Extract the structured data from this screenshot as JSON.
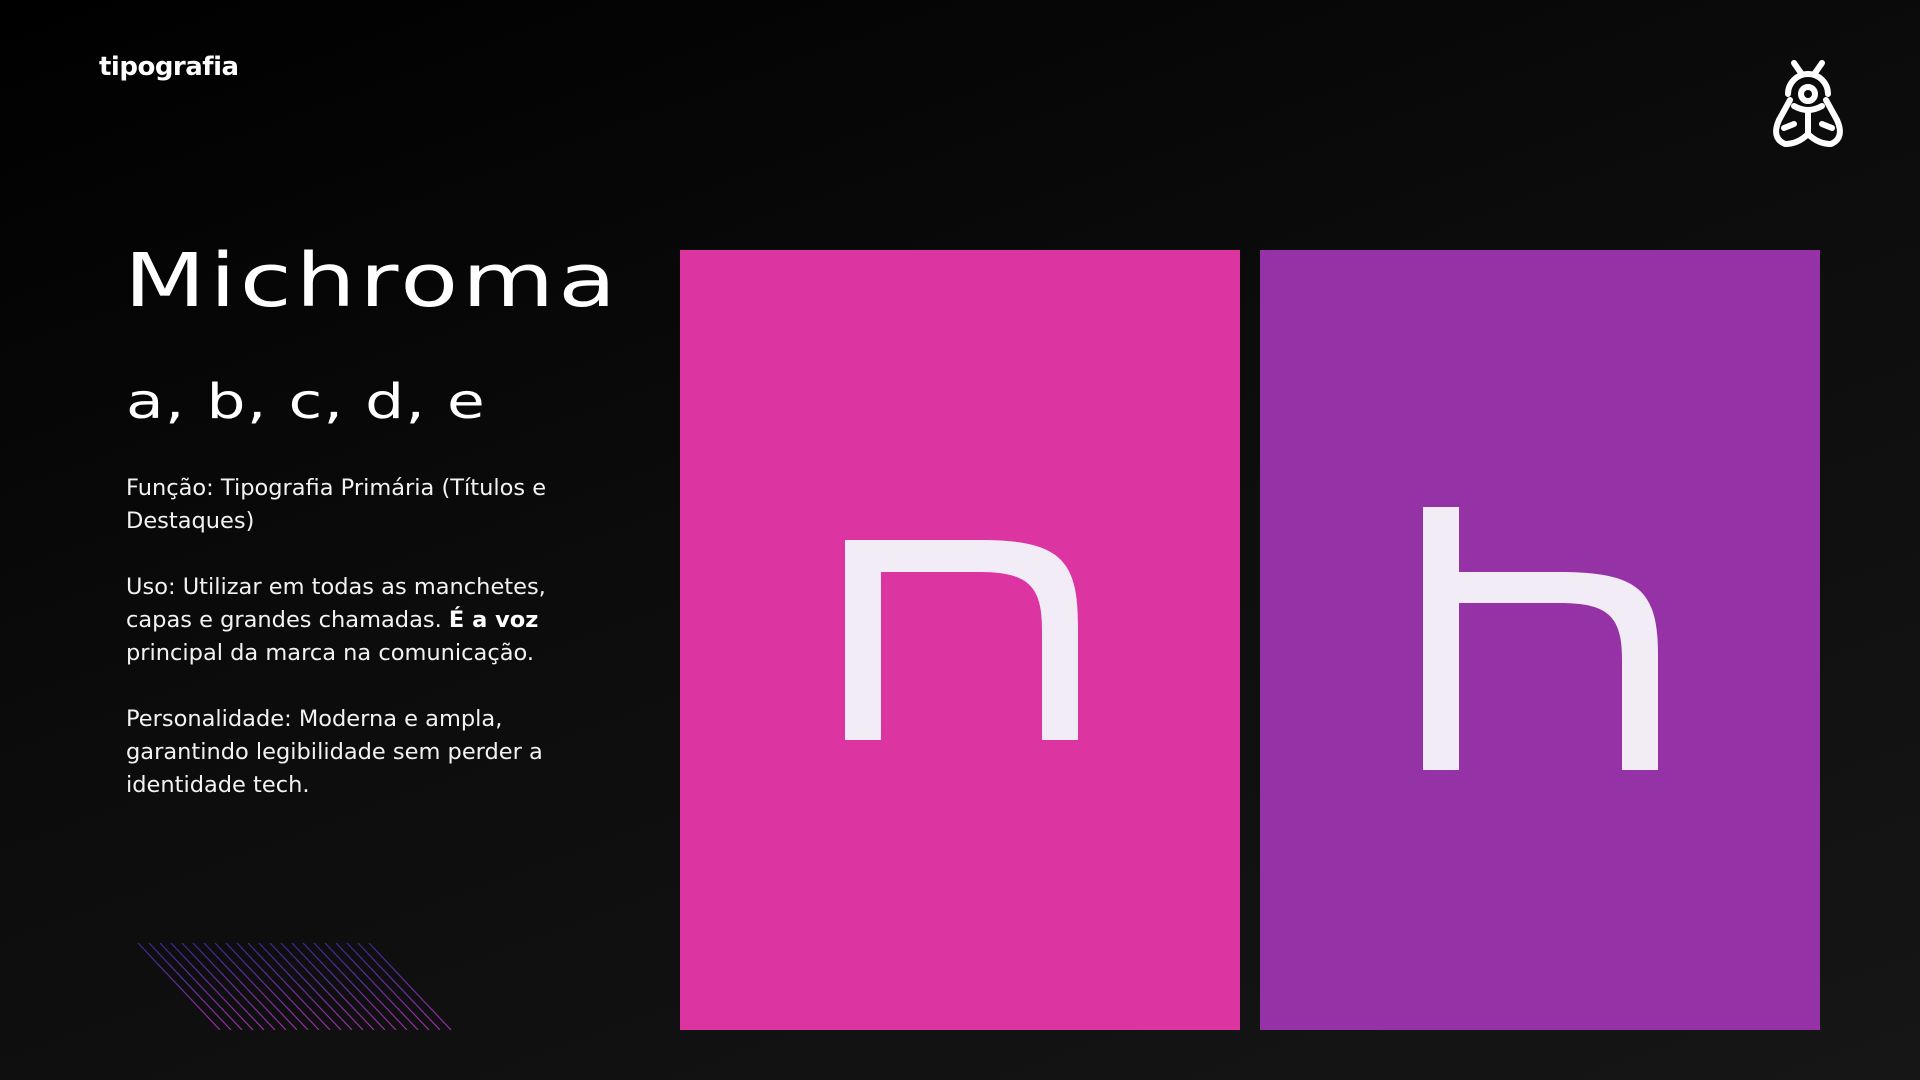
{
  "header": {
    "section_label": "tipografia",
    "logo_icon": "bee-icon"
  },
  "typeface": {
    "name": "Michroma",
    "sample_chars": "a, b, c, d, e"
  },
  "description": {
    "function_text": "Função: Tipografia Primária (Títulos e Destaques)",
    "usage_text": "Uso: Utilizar em todas as manchetes, capas e grandes chamadas.",
    "usage_emphasis": "É a voz",
    "usage_tail": "principal da marca na comunicação.",
    "personality_text": "Personalidade: Moderna e ampla, garantindo legibilidade sem perder a identidade tech."
  },
  "swatches": [
    {
      "letter": "n",
      "color": "#dc34a0",
      "glyph_color": "#f2ecf7"
    },
    {
      "letter": "h",
      "color": "#9533a6",
      "glyph_color": "#f2ecf7"
    }
  ],
  "decoration": {
    "stripe_colors": [
      "#3a2a9a",
      "#9c2fa8"
    ]
  }
}
